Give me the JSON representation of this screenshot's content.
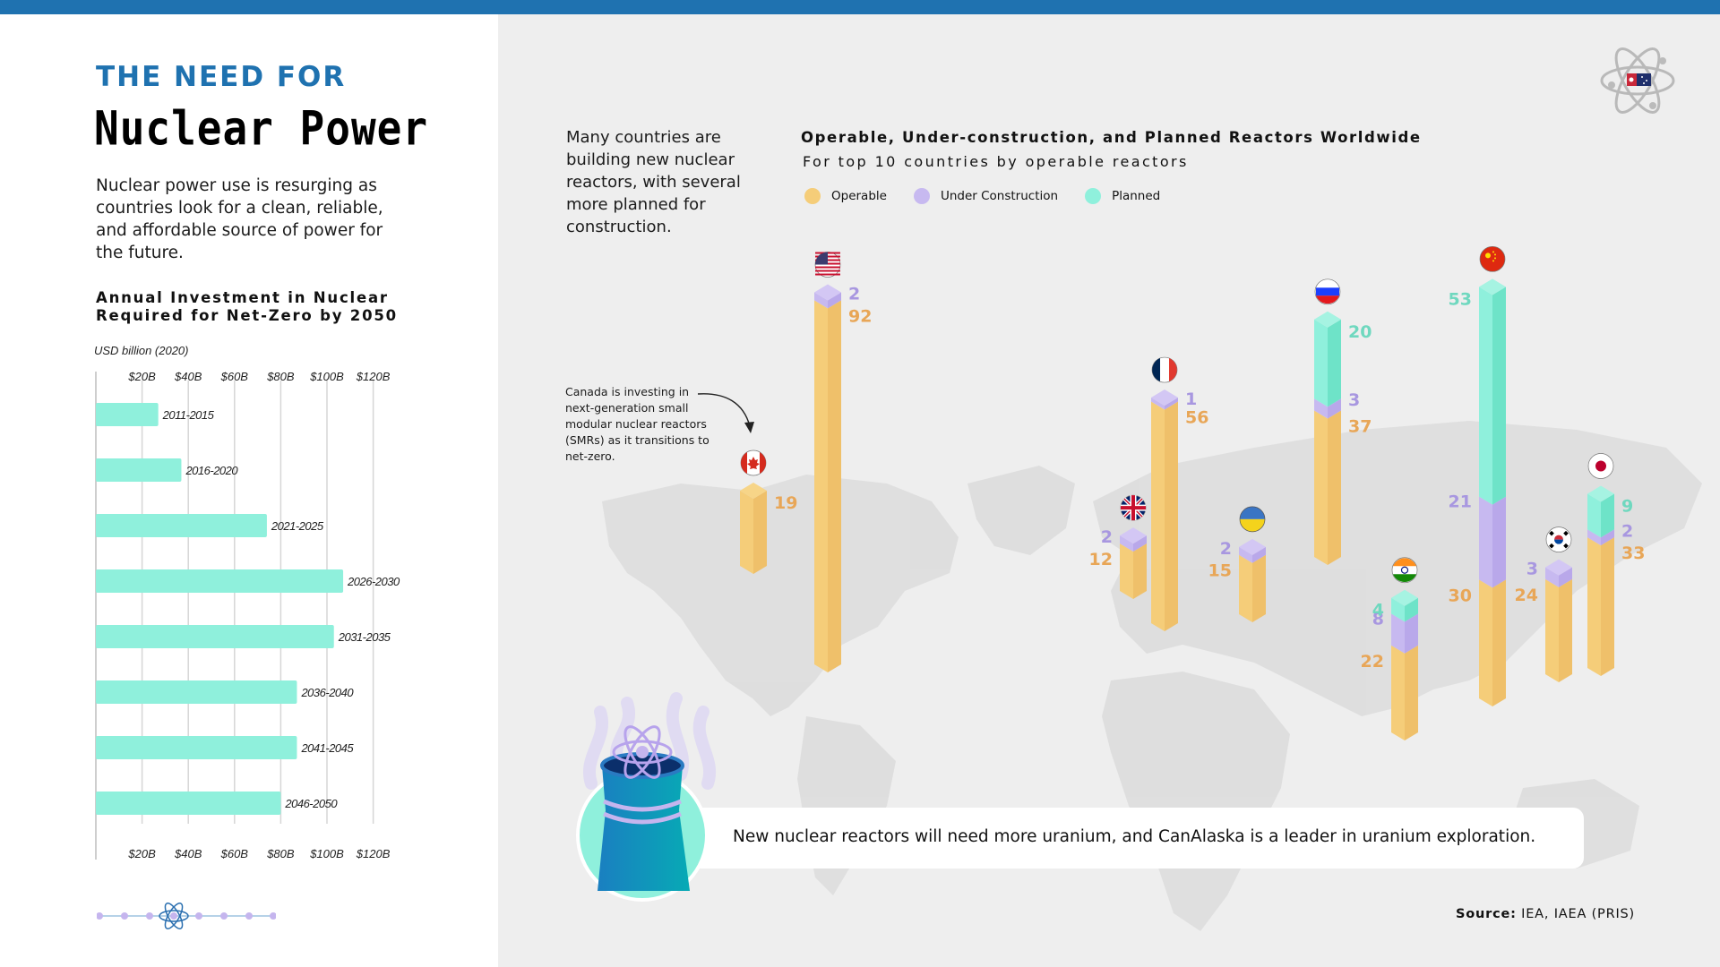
{
  "header": {
    "kicker": "THE NEED FOR",
    "title": "Nuclear Power",
    "intro": "Nuclear power use is resurging as countries look for a clean, reliable, and affordable source of power for the future."
  },
  "colors": {
    "brand_blue": "#1f72b0",
    "operable": "#f5cd79",
    "operable_label": "#e8a657",
    "under_construction": "#c7b9f0",
    "under_construction_label": "#a897e0",
    "planned": "#8ff0dc",
    "planned_label": "#6fd8bf",
    "investment_bar": "#8ff0dc",
    "panel_bg": "#eeeeee"
  },
  "investment": {
    "title_line1": "Annual Investment in Nuclear",
    "title_line2": "Required for Net-Zero by 2050",
    "unit": "USD billion (2020)"
  },
  "reactors": {
    "side_text": "Many countries are building new nuclear reactors, with several more planned for construction.",
    "annotation": "Canada is investing in next-generation small modular nuclear reactors (SMRs) as it transitions to net-zero."
  },
  "callout": {
    "text": "New nuclear reactors will need more uranium, and CanAlaska is a leader in uranium exploration."
  },
  "source": {
    "label": "Source:",
    "text": "IEA, IAEA (PRIS)"
  },
  "icons": {
    "brand_logo": "atom-logo-icon",
    "reactor_badge": "cooling-tower-icon",
    "divider": "atom-divider-icon"
  },
  "chart_data": [
    {
      "type": "bar",
      "orientation": "horizontal",
      "title": "Annual Investment in Nuclear Required for Net-Zero by 2050",
      "xlabel": "USD billion (2020)",
      "ylabel": "",
      "categories": [
        "2011-2015",
        "2016-2020",
        "2021-2025",
        "2026-2030",
        "2031-2035",
        "2036-2040",
        "2041-2045",
        "2046-2050"
      ],
      "values": [
        27,
        37,
        74,
        107,
        103,
        87,
        87,
        80
      ],
      "xlim": [
        0,
        130
      ],
      "ticks": [
        20,
        40,
        60,
        80,
        100,
        120
      ],
      "tick_labels": [
        "$20B",
        "$40B",
        "$60B",
        "$80B",
        "$100B",
        "$120B"
      ],
      "grid": true
    },
    {
      "type": "bar",
      "stacked": true,
      "title": "Operable, Under-construction, and Planned Reactors Worldwide",
      "subtitle": "For top 10 countries by operable reactors",
      "legend": [
        "Operable",
        "Under Construction",
        "Planned"
      ],
      "legend_position": "top-left",
      "categories": [
        "Canada",
        "United States",
        "United Kingdom",
        "France",
        "Ukraine",
        "Russia",
        "India",
        "China",
        "South Korea",
        "Japan"
      ],
      "series": [
        {
          "name": "Operable",
          "values": [
            19,
            92,
            12,
            56,
            15,
            37,
            22,
            30,
            24,
            33
          ]
        },
        {
          "name": "Under Construction",
          "values": [
            0,
            2,
            2,
            1,
            2,
            3,
            8,
            21,
            3,
            2
          ]
        },
        {
          "name": "Planned",
          "values": [
            0,
            0,
            0,
            0,
            0,
            20,
            4,
            53,
            0,
            9
          ]
        }
      ],
      "flags": [
        "flag-canada",
        "flag-usa",
        "flag-uk",
        "flag-france",
        "flag-ukraine",
        "flag-russia",
        "flag-india",
        "flag-china",
        "flag-south-korea",
        "flag-japan"
      ]
    }
  ]
}
